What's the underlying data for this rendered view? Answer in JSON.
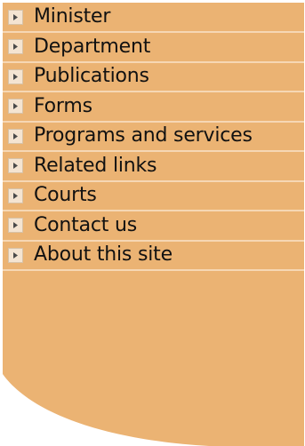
{
  "nav": {
    "items": [
      {
        "label": "Minister",
        "icon": "chevron-right-icon"
      },
      {
        "label": "Department",
        "icon": "chevron-right-icon"
      },
      {
        "label": "Publications",
        "icon": "chevron-right-icon"
      },
      {
        "label": "Forms",
        "icon": "chevron-right-icon"
      },
      {
        "label": "Programs and services",
        "icon": "chevron-right-icon"
      },
      {
        "label": "Related links",
        "icon": "chevron-right-icon"
      },
      {
        "label": "Courts",
        "icon": "chevron-right-icon"
      },
      {
        "label": "Contact us",
        "icon": "chevron-right-icon"
      },
      {
        "label": "About this site",
        "icon": "chevron-right-icon"
      }
    ]
  },
  "colors": {
    "panel": "#ebb373",
    "divider": "#f6d7b4",
    "bullet_bg": "#f4e4d2",
    "bullet_arrow": "#4a4a4a",
    "text": "#111111"
  }
}
